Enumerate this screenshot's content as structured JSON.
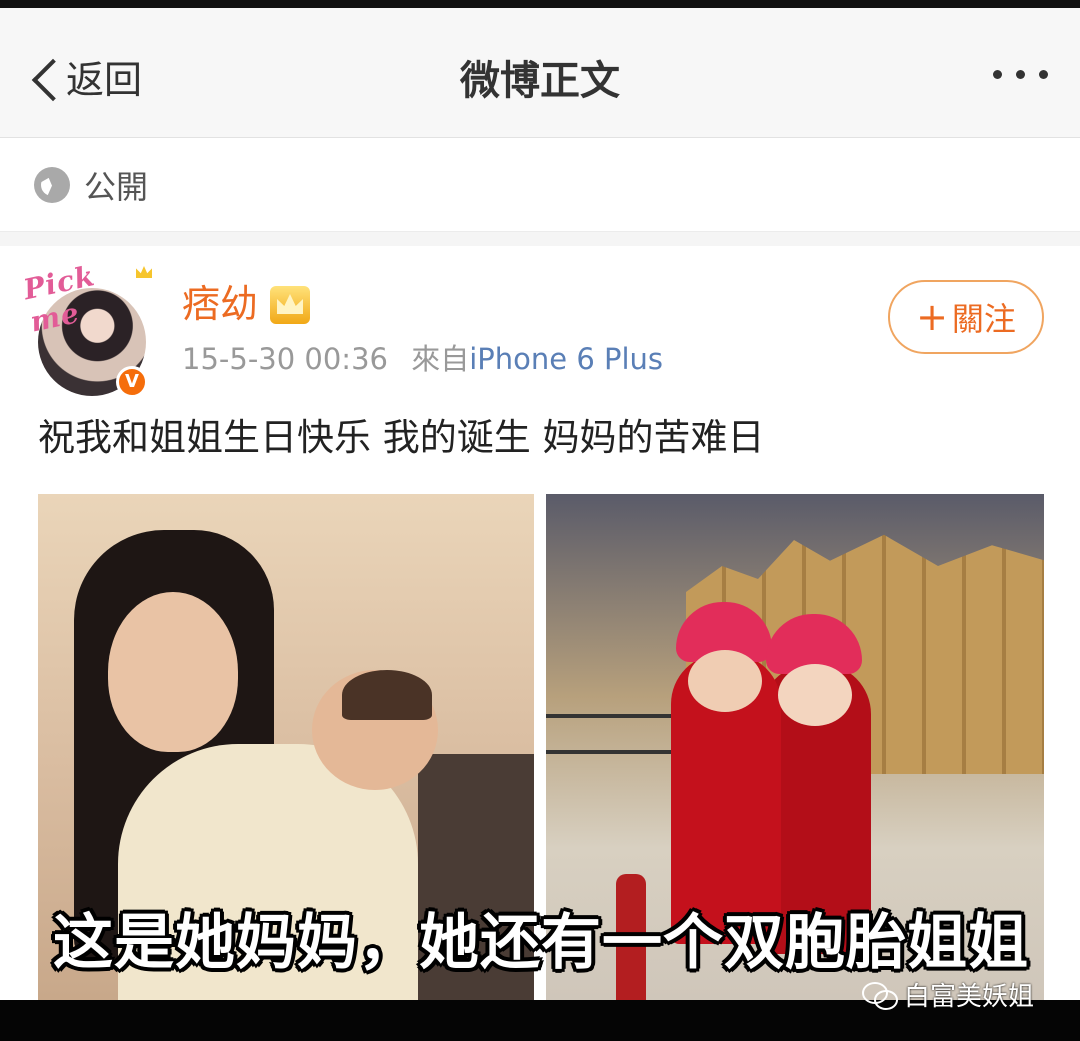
{
  "nav": {
    "back_label": "返回",
    "title": "微博正文",
    "more_icon": "more-icon"
  },
  "visibility": {
    "icon": "globe-icon",
    "label": "公開"
  },
  "post": {
    "avatar_frame_text": "Pick me",
    "verified_badge": "V",
    "username": "痞幼",
    "time": "15-5-30 00:36",
    "source_prefix": "來自",
    "source": "iPhone 6 Plus",
    "follow_plus": "+",
    "follow_label": "關注",
    "text": "祝我和姐姐生日快乐 我的诞生 妈妈的苦难日",
    "images": [
      {
        "description_icon": "photo-mother-baby"
      },
      {
        "description_icon": "photo-twins"
      }
    ],
    "caption": "这是她妈妈，她还有一个双胞胎姐姐"
  },
  "watermark": {
    "icon": "wechat-icon",
    "text": "白富美妖姐"
  },
  "colors": {
    "accent_orange": "#ec6b22",
    "link_blue": "#5a7fb6",
    "meta_gray": "#999999"
  }
}
